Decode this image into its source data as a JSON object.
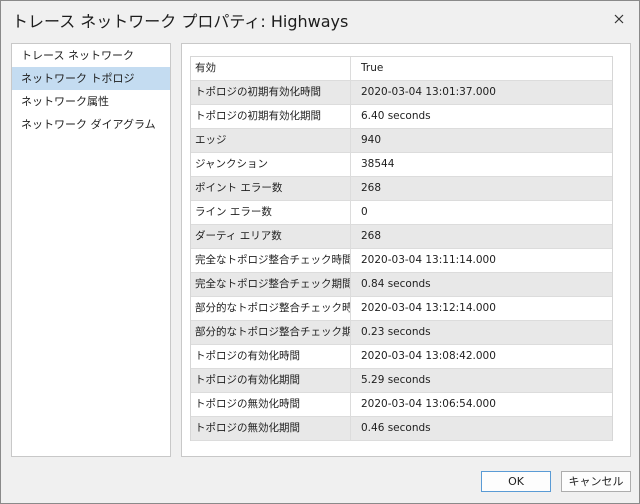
{
  "window": {
    "title": "トレース ネットワーク プロパティ: Highways"
  },
  "nav": {
    "items": [
      {
        "label": "トレース ネットワーク",
        "selected": false
      },
      {
        "label": "ネットワーク トポロジ",
        "selected": true
      },
      {
        "label": "ネットワーク属性",
        "selected": false
      },
      {
        "label": "ネットワーク ダイアグラム",
        "selected": false
      }
    ]
  },
  "properties": [
    {
      "name": "有効",
      "value": "True"
    },
    {
      "name": "トポロジの初期有効化時間",
      "value": "2020-03-04 13:01:37.000"
    },
    {
      "name": "トポロジの初期有効化期間",
      "value": "6.40 seconds"
    },
    {
      "name": "エッジ",
      "value": "940"
    },
    {
      "name": "ジャンクション",
      "value": "38544"
    },
    {
      "name": "ポイント エラー数",
      "value": "268"
    },
    {
      "name": "ライン エラー数",
      "value": "0"
    },
    {
      "name": "ダーティ エリア数",
      "value": "268"
    },
    {
      "name": "完全なトポロジ整合チェック時間",
      "value": "2020-03-04 13:11:14.000"
    },
    {
      "name": "完全なトポロジ整合チェック期間",
      "value": "0.84 seconds"
    },
    {
      "name": "部分的なトポロジ整合チェック時間",
      "value": "2020-03-04 13:12:14.000"
    },
    {
      "name": "部分的なトポロジ整合チェック期間",
      "value": "0.23 seconds"
    },
    {
      "name": "トポロジの有効化時間",
      "value": "2020-03-04 13:08:42.000"
    },
    {
      "name": "トポロジの有効化期間",
      "value": "5.29 seconds"
    },
    {
      "name": "トポロジの無効化時間",
      "value": "2020-03-04 13:06:54.000"
    },
    {
      "name": "トポロジの無効化期間",
      "value": "0.46 seconds"
    }
  ],
  "buttons": {
    "ok": "OK",
    "cancel": "キャンセル"
  },
  "colors": {
    "selected_nav": "#c4dcf1",
    "alt_row": "#e8e8e8",
    "ok_border": "#5a9bd5"
  },
  "icons": {
    "close": "close-icon"
  }
}
